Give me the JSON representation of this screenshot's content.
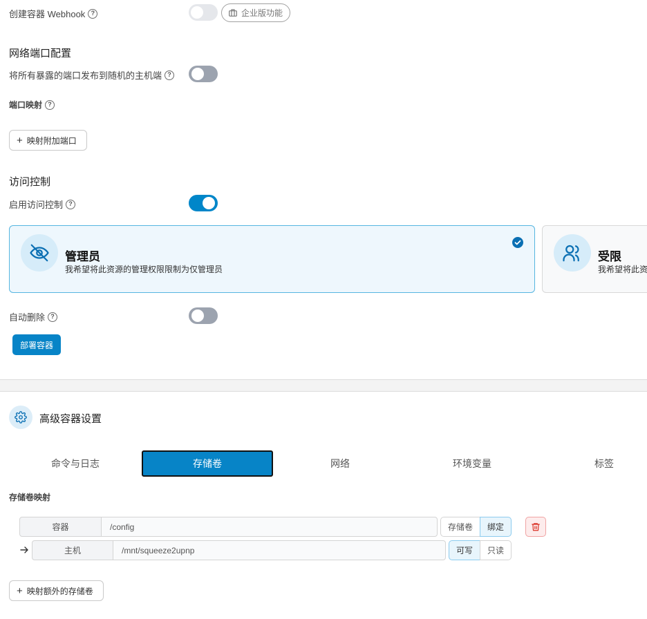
{
  "webhook": {
    "label": "创建容器 Webhook",
    "business_label": "企业版功能"
  },
  "network": {
    "section_title": "网络端口配置",
    "publish_label": "将所有暴露的端口发布到随机的主机端",
    "port_mapping_label": "端口映射",
    "add_port_label": "映射附加端口"
  },
  "access": {
    "section_title": "访问控制",
    "enable_label": "启用访问控制",
    "admin_card": {
      "title": "管理员",
      "desc": "我希望将此资源的管理权限限制为仅管理员"
    },
    "restricted_card": {
      "title": "受限",
      "desc": "我希望将此资源"
    }
  },
  "auto_remove_label": "自动删除",
  "deploy_button": "部署容器",
  "advanced": {
    "title": "高级容器设置",
    "tabs": [
      "命令与日志",
      "存储卷",
      "网络",
      "环境变量",
      "标签"
    ],
    "active_tab": 1
  },
  "volumes": {
    "section_label": "存储卷映射",
    "container_label": "容器",
    "container_path": "/config",
    "type_volume": "存储卷",
    "type_bind": "绑定",
    "host_label": "主机",
    "host_path": "/mnt/squeeze2upnp",
    "mode_writable": "可写",
    "mode_readonly": "只读",
    "add_volume_label": "映射额外的存储卷"
  },
  "colors": {
    "accent": "#0784c7",
    "toggle_on": "#0086c9",
    "toggle_off": "#9ca3af",
    "danger": "#d92d20"
  }
}
